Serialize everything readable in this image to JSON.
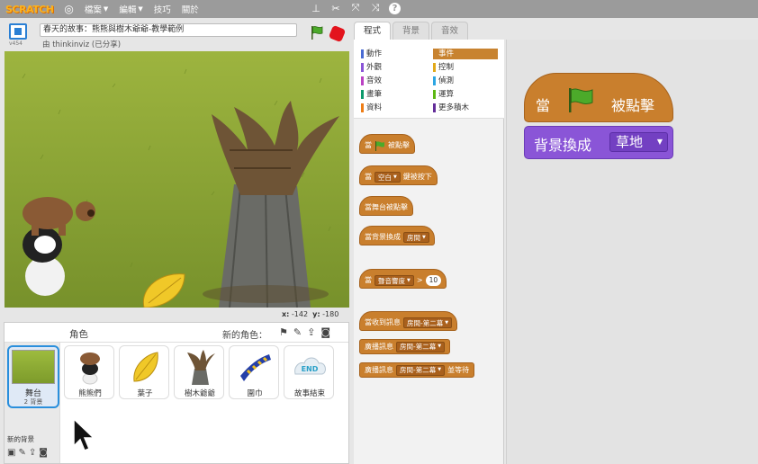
{
  "menubar": {
    "logo": "SCRATCH",
    "file": "檔案",
    "edit": "編輯",
    "tips": "技巧",
    "about": "關於"
  },
  "stage_header": {
    "version": "v454",
    "project_title": "春天的故事：熊熊與樹木爺爺-教學範例",
    "byline": "由 thinkinviz (已分享)"
  },
  "coords": {
    "x_label": "x:",
    "x": "-142",
    "y_label": "y:",
    "y": "-180"
  },
  "sprite_pane": {
    "title": "角色",
    "new_sprite": "新的角色：",
    "stage_label": "舞台",
    "stage_sub": "2 背景",
    "new_backdrop": "新的背景",
    "sprites": [
      {
        "name": "熊熊們"
      },
      {
        "name": "葉子"
      },
      {
        "name": "樹木爺爺"
      },
      {
        "name": "圍巾"
      },
      {
        "name": "故事結束"
      }
    ],
    "end_badge": "END"
  },
  "tabs": [
    "程式",
    "背景",
    "音效"
  ],
  "categories": [
    {
      "label": "動作",
      "color": "#4a6cd4"
    },
    {
      "label": "外觀",
      "color": "#8a55d7"
    },
    {
      "label": "音效",
      "color": "#bb42c3"
    },
    {
      "label": "畫筆",
      "color": "#0e9a6c"
    },
    {
      "label": "資料",
      "color": "#ee7d16"
    },
    {
      "label": "事件",
      "color": "#c88330"
    },
    {
      "label": "控制",
      "color": "#e1a91a"
    },
    {
      "label": "偵測",
      "color": "#2ca5e2"
    },
    {
      "label": "運算",
      "color": "#5cb712"
    },
    {
      "label": "更多積木",
      "color": "#632d99"
    }
  ],
  "blocks": {
    "b1_a": "當",
    "b1_b": "被點擊",
    "b2_a": "當",
    "b2_key": "空白",
    "b2_b": "鍵被按下",
    "b3": "當舞台被點擊",
    "b4_a": "當背景換成",
    "b4_dd": "房間",
    "b5_a": "當",
    "b5_dd": "聲音響度",
    "b5_op": ">",
    "b5_num": "10",
    "b6_a": "當收到訊息",
    "b6_dd": "房間-第二幕",
    "b7_a": "廣播訊息",
    "b7_dd": "房間-第二幕",
    "b8_a": "廣播訊息",
    "b8_dd": "房間-第二幕",
    "b8_b": "並等待"
  },
  "script": {
    "hat_a": "當",
    "hat_b": "被點擊",
    "switch_label": "背景換成",
    "switch_value": "草地"
  },
  "colors": {
    "events": "#c97f2d",
    "looks": "#8a55d7",
    "accent": "#2a8fdc"
  }
}
